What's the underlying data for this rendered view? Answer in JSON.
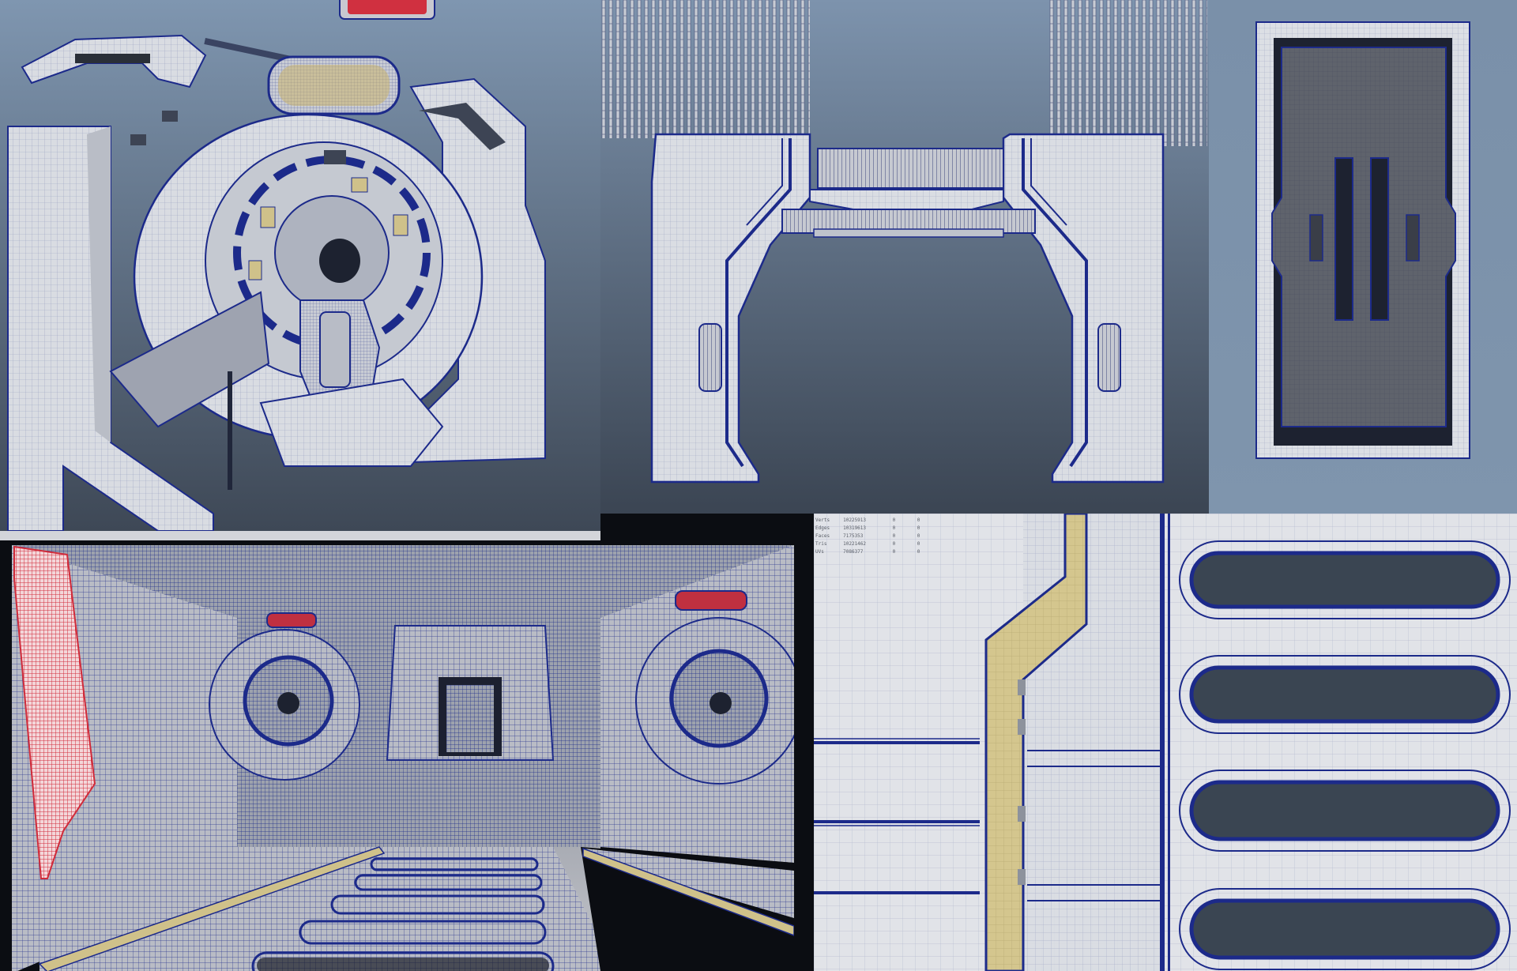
{
  "scene": {
    "panels": [
      {
        "id": "portal-wireframe",
        "subject": "circular-hatch"
      },
      {
        "id": "gate-wireframe",
        "subject": "gate-frame"
      },
      {
        "id": "door-wireframe",
        "subject": "vertical-door"
      },
      {
        "id": "corridor-perspective",
        "subject": "corridor"
      },
      {
        "id": "floor-closeup",
        "subject": "floor-vents"
      }
    ]
  },
  "hud": {
    "rows": [
      {
        "label": "Verts",
        "value": "10225913",
        "c1": "0",
        "c2": "0"
      },
      {
        "label": "Edges",
        "value": "10319613",
        "c1": "0",
        "c2": "0"
      },
      {
        "label": "Faces",
        "value": "7175353",
        "c1": "0",
        "c2": "0"
      },
      {
        "label": "Tris",
        "value": "10221462",
        "c1": "0",
        "c2": "0"
      },
      {
        "label": "UVs",
        "value": "7086377",
        "c1": "0",
        "c2": "0"
      }
    ]
  },
  "colors": {
    "background_top": "#7c93ad",
    "background_bottom": "#3c4654",
    "mesh_surface": "#d8dbe0",
    "wire": "#1c2a8a",
    "accent_yellow": "#cfc18a",
    "accent_red": "#d03040",
    "dark_slot": "#3a4552"
  }
}
